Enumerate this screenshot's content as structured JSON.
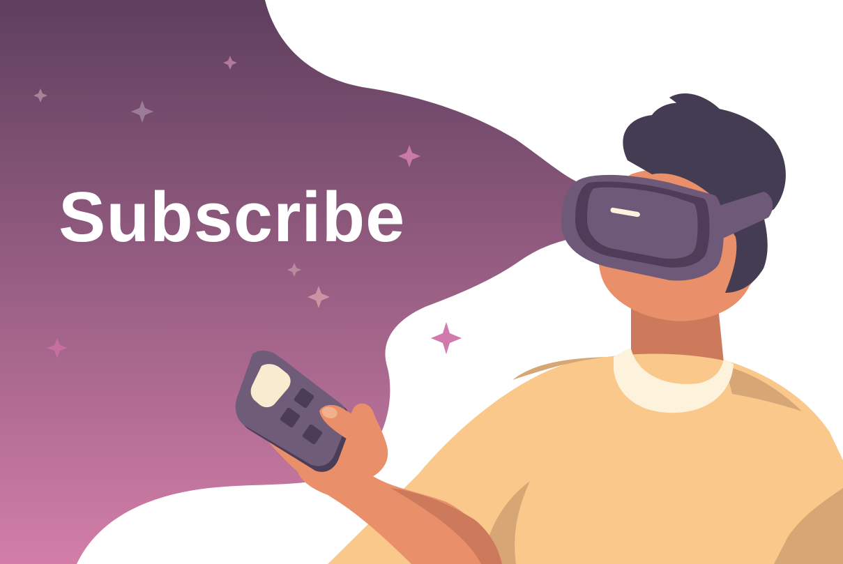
{
  "headline": "Subscribe",
  "colors": {
    "gradient_top": "#5e3f5e",
    "gradient_bottom": "#d27ea8",
    "sparkle_pink": "#d07aad",
    "sparkle_muted": "#a8849a",
    "skin": "#e9906a",
    "skin_shadow": "#cd7a5c",
    "hair": "#443c52",
    "headset": "#6e5a78",
    "headset_dark": "#4f3c59",
    "shirt": "#fbc88b",
    "shirt_shadow": "#d6a775",
    "collar": "#fdf2dc",
    "controller": "#6f5c79",
    "controller_button": "#4b3c57",
    "controller_screen": "#f8ebcf"
  },
  "icons": [
    "sparkle-icon",
    "vr-headset-icon",
    "remote-controller-icon"
  ]
}
